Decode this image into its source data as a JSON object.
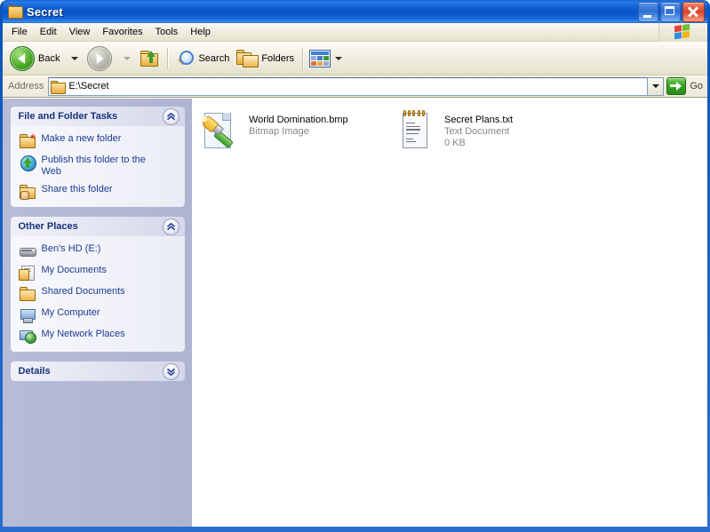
{
  "window": {
    "title": "Secret",
    "title_icon": "folder-icon",
    "buttons": {
      "minimize": "Minimize",
      "maximize": "Maximize",
      "close": "Close"
    }
  },
  "menubar": {
    "items": [
      {
        "label": "File"
      },
      {
        "label": "Edit"
      },
      {
        "label": "View"
      },
      {
        "label": "Favorites"
      },
      {
        "label": "Tools"
      },
      {
        "label": "Help"
      }
    ],
    "logo_icon": "windows-flag-icon"
  },
  "toolbar": {
    "back_label": "Back",
    "back_icon": "back-arrow-icon",
    "back_dropdown_icon": "chevron-down-icon",
    "forward_icon": "forward-arrow-icon",
    "forward_dropdown_icon": "chevron-down-icon",
    "up_icon": "up-folder-icon",
    "search_label": "Search",
    "search_icon": "magnifier-icon",
    "folders_label": "Folders",
    "folders_icon": "folders-icon",
    "views_icon": "views-icon",
    "views_dropdown_icon": "chevron-down-icon"
  },
  "address": {
    "label": "Address",
    "value": "E:\\Secret",
    "icon": "folder-icon",
    "dropdown_icon": "chevron-down-icon",
    "go_label": "Go",
    "go_icon": "go-arrow-icon"
  },
  "sidebar": {
    "panels": [
      {
        "title": "File and Folder Tasks",
        "collapsed": false,
        "toggle_icon": "chevron-up-icon",
        "items": [
          {
            "label": "Make a new folder",
            "icon": "new-folder-icon"
          },
          {
            "label": "Publish this folder to the Web",
            "icon": "publish-web-icon"
          },
          {
            "label": "Share this folder",
            "icon": "share-folder-icon"
          }
        ]
      },
      {
        "title": "Other Places",
        "collapsed": false,
        "toggle_icon": "chevron-up-icon",
        "items": [
          {
            "label": "Ben's HD (E:)",
            "icon": "hard-drive-icon"
          },
          {
            "label": "My Documents",
            "icon": "my-documents-icon"
          },
          {
            "label": "Shared Documents",
            "icon": "shared-documents-icon"
          },
          {
            "label": "My Computer",
            "icon": "my-computer-icon"
          },
          {
            "label": "My Network Places",
            "icon": "my-network-places-icon"
          }
        ]
      },
      {
        "title": "Details",
        "collapsed": true,
        "toggle_icon": "chevron-down-icon",
        "items": []
      }
    ]
  },
  "content": {
    "files": [
      {
        "name": "World Domination.bmp",
        "type": "Bitmap Image",
        "size": "",
        "icon": "bitmap-image-icon"
      },
      {
        "name": "Secret Plans.txt",
        "type": "Text Document",
        "size": "0 KB",
        "icon": "text-document-icon"
      }
    ]
  },
  "colors": {
    "titlebar_blue": "#0a5ad0",
    "sidebar_lavender": "#b3b9d6",
    "panel_title_blue": "#16327a",
    "link_blue": "#1b3a92",
    "content_white": "#ffffff",
    "toolbar_beige": "#ece9d8",
    "close_red": "#d9452b"
  }
}
